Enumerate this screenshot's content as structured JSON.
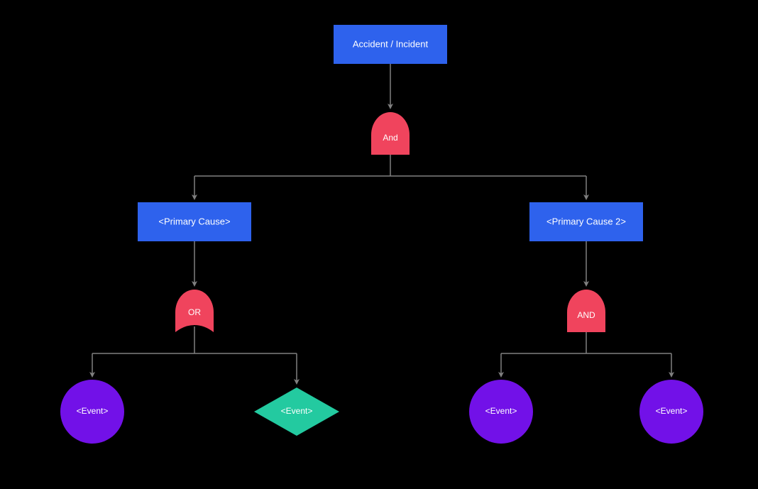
{
  "nodes": {
    "root": {
      "label": "Accident / Incident"
    },
    "gate1": {
      "label": "And"
    },
    "primary1": {
      "label": "<Primary Cause>"
    },
    "primary2": {
      "label": "<Primary Cause 2>"
    },
    "gate2": {
      "label": "OR"
    },
    "gate3": {
      "label": "AND"
    },
    "event1": {
      "label": "<Event>"
    },
    "event2": {
      "label": "<Event>"
    },
    "event3": {
      "label": "<Event>"
    },
    "event4": {
      "label": "<Event>"
    }
  },
  "colors": {
    "blue": "#2e62ed",
    "red": "#f0445d",
    "purple": "#7211e8",
    "green": "#23caa0",
    "arrow": "#808080"
  }
}
